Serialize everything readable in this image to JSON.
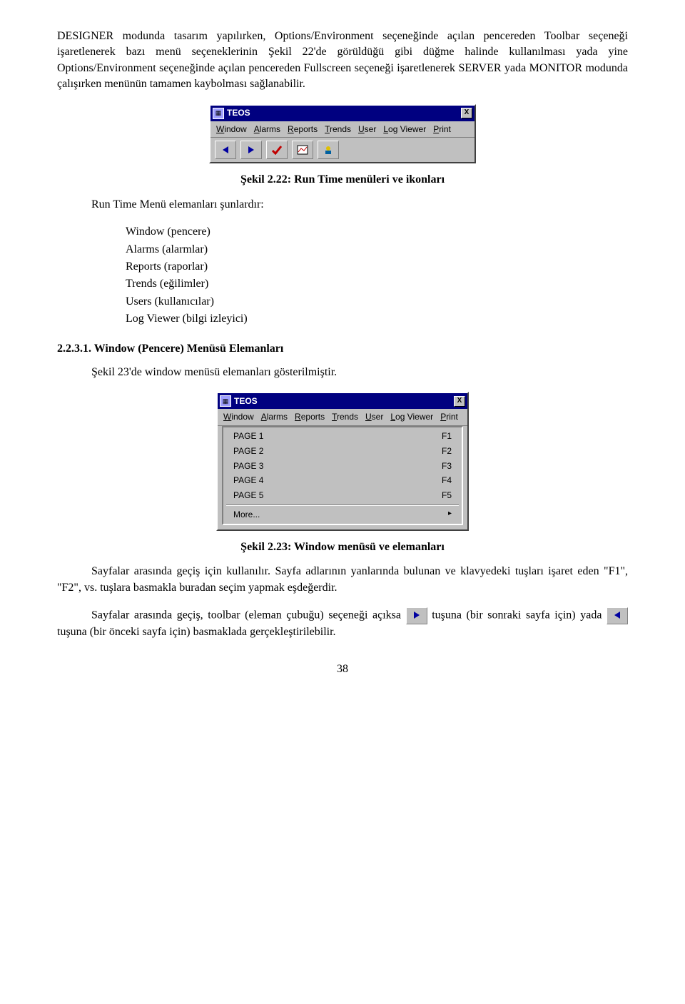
{
  "para1": "DESIGNER modunda tasarım yapılırken, Options/Environment seçeneğinde açılan pencereden Toolbar seçeneği işaretlenerek bazı menü seçeneklerinin Şekil 22'de görüldüğü gibi düğme halinde kullanılması yada yine Options/Environment seçeneğinde açılan pencereden Fullscreen seçeneği işaretlenerek SERVER yada MONITOR modunda çalışırken menünün tamamen kaybolması sağlanabilir.",
  "teos": {
    "title": "TEOS",
    "menu": [
      "Window",
      "Alarms",
      "Reports",
      "Trends",
      "User",
      "Log Viewer",
      "Print"
    ]
  },
  "caption1": "Şekil 2.22: Run Time menüleri ve ikonları",
  "runtime_intro": "Run Time Menü elemanları şunlardır:",
  "runtime_list": [
    "Window (pencere)",
    "Alarms (alarmlar)",
    "Reports (raporlar)",
    "Trends (eğilimler)",
    "Users (kullanıcılar)",
    "Log Viewer (bilgi izleyici)"
  ],
  "section_title": "2.2.3.1. Window (Pencere) Menüsü Elemanları",
  "para2": "Şekil 23'de window menüsü elemanları gösterilmiştir.",
  "window_menu": [
    {
      "label": "PAGE 1",
      "key": "F1"
    },
    {
      "label": "PAGE 2",
      "key": "F2"
    },
    {
      "label": "PAGE 3",
      "key": "F3"
    },
    {
      "label": "PAGE 4",
      "key": "F4"
    },
    {
      "label": "PAGE 5",
      "key": "F5"
    },
    {
      "label": "More...",
      "key": "▸"
    }
  ],
  "caption2": "Şekil 2.23: Window menüsü ve elemanları",
  "para3": "Sayfalar arasında geçiş için kullanılır. Sayfa adlarının yanlarında bulunan ve klavyedeki tuşları işaret eden \"F1\", \"F2\",  vs. tuşlara basmakla buradan seçim yapmak eşdeğerdir.",
  "para4a": "Sayfalar arasında geçiş, toolbar (eleman çubuğu) seçeneği açıksa ",
  "para4b": " tuşuna (bir sonraki sayfa için) yada ",
  "para4c": " tuşuna (bir önceki sayfa için) basmaklada gerçekleştirilebilir.",
  "pagenum": "38"
}
